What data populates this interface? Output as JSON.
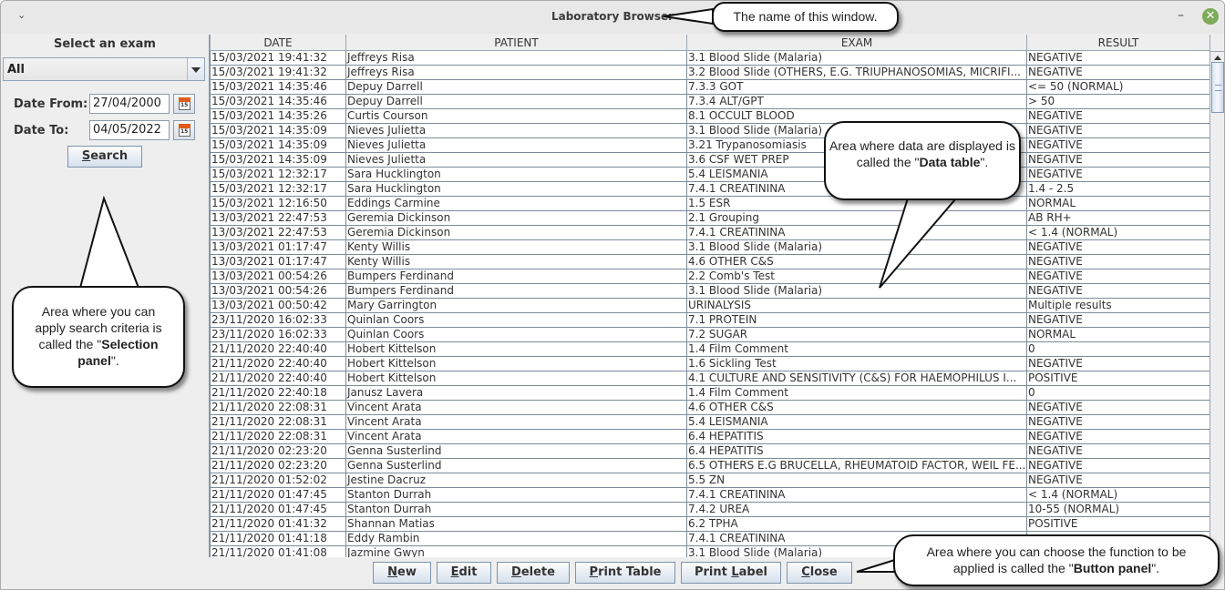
{
  "window": {
    "title": "Laboratory Browser",
    "menu_icon": "chevron-down-icon",
    "minimize_glyph": "–",
    "close_glyph": "✕"
  },
  "selection": {
    "label": "Select an exam",
    "exam_value": "All",
    "date_from_label": "Date From:",
    "date_from": "27/04/2000",
    "date_to_label": "Date To:",
    "date_to": "04/05/2022",
    "search_label": "Search",
    "search_mnemonic": "S",
    "search_rest": "earch"
  },
  "table": {
    "columns": [
      "DATE",
      "PATIENT",
      "EXAM",
      "RESULT"
    ],
    "rows": [
      [
        "15/03/2021 19:41:32",
        "Jeffreys Risa",
        "3.1 Blood Slide (Malaria)",
        "NEGATIVE"
      ],
      [
        "15/03/2021 19:41:32",
        "Jeffreys Risa",
        "3.2 Blood Slide (OTHERS, E.G. TRIUPHANOSOMIAS, MICRIFI...",
        "NEGATIVE"
      ],
      [
        "15/03/2021 14:35:46",
        "Depuy Darrell",
        "7.3.3 GOT",
        "<= 50 (NORMAL)"
      ],
      [
        "15/03/2021 14:35:46",
        "Depuy Darrell",
        "7.3.4 ALT/GPT",
        "> 50"
      ],
      [
        "15/03/2021 14:35:26",
        "Curtis Courson",
        "8.1 OCCULT BLOOD",
        "NEGATIVE"
      ],
      [
        "15/03/2021 14:35:09",
        "Nieves Julietta",
        "3.1 Blood Slide (Malaria)",
        "NEGATIVE"
      ],
      [
        "15/03/2021 14:35:09",
        "Nieves Julietta",
        "3.21 Trypanosomiasis",
        "NEGATIVE"
      ],
      [
        "15/03/2021 14:35:09",
        "Nieves Julietta",
        "3.6 CSF WET PREP",
        "NEGATIVE"
      ],
      [
        "15/03/2021 12:32:17",
        "Sara Hucklington",
        "5.4 LEISMANIA",
        "NEGATIVE"
      ],
      [
        "15/03/2021 12:32:17",
        "Sara Hucklington",
        "7.4.1 CREATININA",
        "1.4 - 2.5"
      ],
      [
        "15/03/2021 12:16:50",
        "Eddings Carmine",
        "1.5 ESR",
        "NORMAL"
      ],
      [
        "13/03/2021 22:47:53",
        "Geremia Dickinson",
        "2.1 Grouping",
        "AB RH+"
      ],
      [
        "13/03/2021 22:47:53",
        "Geremia Dickinson",
        "7.4.1 CREATININA",
        "< 1.4 (NORMAL)"
      ],
      [
        "13/03/2021 01:17:47",
        "Kenty Willis",
        "3.1 Blood Slide (Malaria)",
        "NEGATIVE"
      ],
      [
        "13/03/2021 01:17:47",
        "Kenty Willis",
        "4.6 OTHER C&S",
        "NEGATIVE"
      ],
      [
        "13/03/2021 00:54:26",
        "Bumpers Ferdinand",
        "2.2 Comb's Test",
        "NEGATIVE"
      ],
      [
        "13/03/2021 00:54:26",
        "Bumpers Ferdinand",
        "3.1 Blood Slide (Malaria)",
        "NEGATIVE"
      ],
      [
        "13/03/2021 00:50:42",
        "Mary Garrington",
        "URINALYSIS",
        "Multiple results"
      ],
      [
        "23/11/2020 16:02:33",
        "Quinlan Coors",
        "7.1 PROTEIN",
        "NEGATIVE"
      ],
      [
        "23/11/2020 16:02:33",
        "Quinlan Coors",
        "7.2 SUGAR",
        "NORMAL"
      ],
      [
        "21/11/2020 22:40:40",
        "Hobert Kittelson",
        "1.4 Film Comment",
        "0"
      ],
      [
        "21/11/2020 22:40:40",
        "Hobert Kittelson",
        "1.6 Sickling Test",
        "NEGATIVE"
      ],
      [
        "21/11/2020 22:40:40",
        "Hobert Kittelson",
        "4.1 CULTURE AND SENSITIVITY (C&S) FOR HAEMOPHILUS I...",
        "POSITIVE"
      ],
      [
        "21/11/2020 22:40:18",
        "Janusz Lavera",
        "1.4 Film Comment",
        "0"
      ],
      [
        "21/11/2020 22:08:31",
        "Vincent Arata",
        "4.6 OTHER C&S",
        "NEGATIVE"
      ],
      [
        "21/11/2020 22:08:31",
        "Vincent Arata",
        "5.4 LEISMANIA",
        "NEGATIVE"
      ],
      [
        "21/11/2020 22:08:31",
        "Vincent Arata",
        "6.4 HEPATITIS",
        "NEGATIVE"
      ],
      [
        "21/11/2020 02:23:20",
        "Genna Susterlind",
        "6.4 HEPATITIS",
        "NEGATIVE"
      ],
      [
        "21/11/2020 02:23:20",
        "Genna Susterlind",
        "6.5 OTHERS E.G BRUCELLA, RHEUMATOID FACTOR, WEIL FE...",
        "NEGATIVE"
      ],
      [
        "21/11/2020 01:52:02",
        "Jestine Dacruz",
        "5.5 ZN",
        "NEGATIVE"
      ],
      [
        "21/11/2020 01:47:45",
        "Stanton Durrah",
        "7.4.1 CREATININA",
        "< 1.4 (NORMAL)"
      ],
      [
        "21/11/2020 01:47:45",
        "Stanton Durrah",
        "7.4.2 UREA",
        "10-55 (NORMAL)"
      ],
      [
        "21/11/2020 01:41:32",
        "Shannan Matias",
        "6.2 TPHA",
        "POSITIVE"
      ],
      [
        "21/11/2020 01:41:18",
        "Eddy Rambin",
        "7.4.1 CREATININA",
        ""
      ],
      [
        "21/11/2020 01:41:08",
        "Jazmine Gwyn",
        "3.1 Blood Slide (Malaria)",
        ""
      ]
    ]
  },
  "buttons": [
    {
      "key": "new",
      "mn": "N",
      "rest": "ew"
    },
    {
      "key": "edit",
      "mn": "E",
      "rest": "dit"
    },
    {
      "key": "delete",
      "mn": "D",
      "rest": "elete"
    },
    {
      "key": "print-table",
      "mn": "P",
      "rest": "rint Table"
    },
    {
      "key": "print-label",
      "pre": "Print ",
      "mn": "L",
      "rest": "abel"
    },
    {
      "key": "close",
      "mn": "C",
      "rest": "lose"
    }
  ],
  "callouts": {
    "window_name": "The name of this window.",
    "data_table_pre": "Area where data are displayed is called the \"",
    "data_table_bold": "Data table",
    "data_table_post": "\".",
    "selection_pre": "Area where you can apply search criteria is called the \"",
    "selection_bold": "Selection panel",
    "selection_post": "\".",
    "button_pre": "Area where you can choose the function to be applied is called the \"",
    "button_bold": "Button panel",
    "button_post": "\"."
  }
}
